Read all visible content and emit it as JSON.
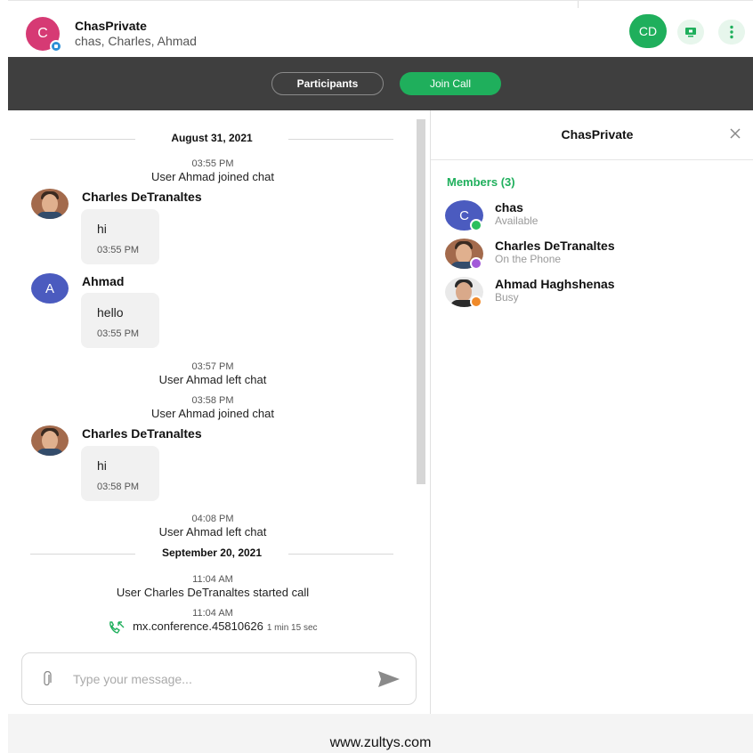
{
  "header": {
    "avatar_initial": "C",
    "title": "ChasPrivate",
    "subtitle": "chas, Charles, Ahmad",
    "user_initials": "CD",
    "accent": "#1faf5c"
  },
  "toolbar": {
    "participants_label": "Participants",
    "join_call_label": "Join Call"
  },
  "chat": {
    "date1": "August 31, 2021",
    "sys1": {
      "time": "03:55 PM",
      "text": "User Ahmad joined chat"
    },
    "msg1": {
      "sender": "Charles DeTranaltes",
      "text": "hi",
      "time": "03:55 PM"
    },
    "msg2": {
      "avatar_initial": "A",
      "sender": "Ahmad",
      "text": "hello",
      "time": "03:55 PM"
    },
    "sys2": {
      "time": "03:57 PM",
      "text": "User Ahmad left chat"
    },
    "sys3": {
      "time": "03:58 PM",
      "text": "User Ahmad joined chat"
    },
    "msg3": {
      "sender": "Charles DeTranaltes",
      "text": "hi",
      "time": "03:58 PM"
    },
    "sys4": {
      "time": "04:08 PM",
      "text": "User Ahmad left chat"
    },
    "date2": "September 20, 2021",
    "sys5": {
      "time": "11:04 AM",
      "text": "User Charles DeTranaltes started call"
    },
    "call": {
      "time": "11:04 AM",
      "name": "mx.conference.45810626",
      "duration": "1 min 15 sec"
    }
  },
  "composer": {
    "placeholder": "Type your message..."
  },
  "panel": {
    "title": "ChasPrivate",
    "members_label": "Members (3)",
    "members": [
      {
        "initial": "C",
        "name": "chas",
        "status": "Available",
        "status_color": "#2bbf5e"
      },
      {
        "name": "Charles DeTranaltes",
        "status": "On the Phone",
        "status_color": "#a259d9"
      },
      {
        "name": "Ahmad Haghshenas",
        "status": "Busy",
        "status_color": "#f08a2a"
      }
    ]
  },
  "footer": {
    "url": "www.zultys.com"
  }
}
